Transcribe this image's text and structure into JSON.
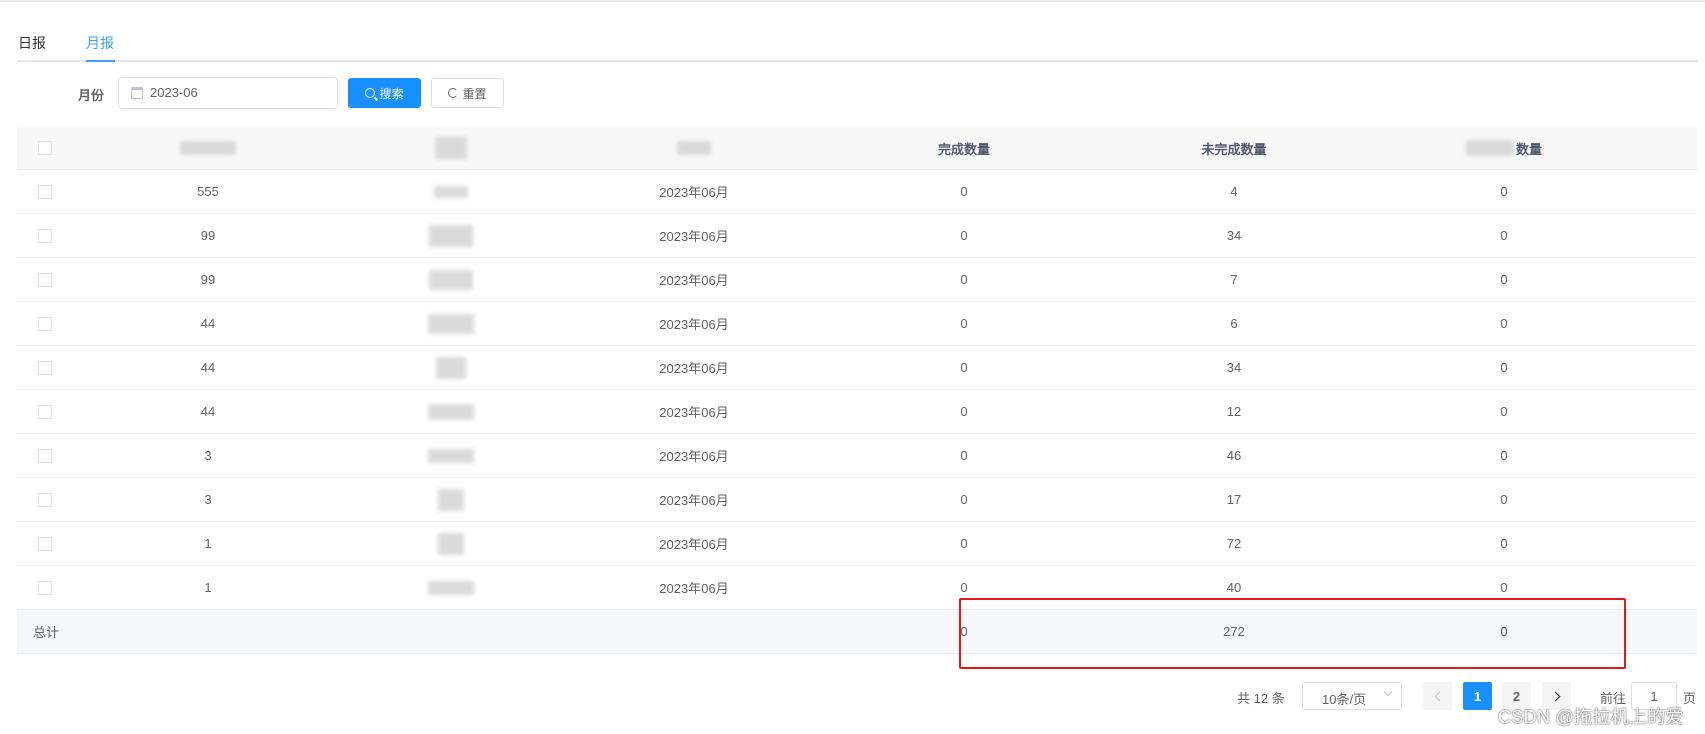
{
  "tabs": [
    {
      "label": "日报"
    },
    {
      "label": "月报"
    }
  ],
  "form": {
    "month_label": "月份",
    "month_value": "2023-06",
    "search_label": "搜索",
    "reset_label": "重置"
  },
  "table": {
    "headers": {
      "col3": "完成数量",
      "col4": "未完成数量",
      "col5_suffix": "数量"
    },
    "rows": [
      {
        "c1": "555",
        "month": "2023年06月",
        "done": "0",
        "undone": "4",
        "c5": "0"
      },
      {
        "c1": "99",
        "month": "2023年06月",
        "done": "0",
        "undone": "34",
        "c5": "0"
      },
      {
        "c1": "99",
        "month": "2023年06月",
        "done": "0",
        "undone": "7",
        "c5": "0"
      },
      {
        "c1": "44",
        "month": "2023年06月",
        "done": "0",
        "undone": "6",
        "c5": "0"
      },
      {
        "c1": "44",
        "month": "2023年06月",
        "done": "0",
        "undone": "34",
        "c5": "0"
      },
      {
        "c1": "44",
        "month": "2023年06月",
        "done": "0",
        "undone": "12",
        "c5": "0"
      },
      {
        "c1": "3",
        "month": "2023年06月",
        "done": "0",
        "undone": "46",
        "c5": "0"
      },
      {
        "c1": "3",
        "month": "2023年06月",
        "done": "0",
        "undone": "17",
        "c5": "0"
      },
      {
        "c1": "1",
        "month": "2023年06月",
        "done": "0",
        "undone": "72",
        "c5": "0"
      },
      {
        "c1": "1",
        "month": "2023年06月",
        "done": "0",
        "undone": "40",
        "c5": "0"
      }
    ],
    "footer": {
      "label": "总计",
      "done": "0",
      "undone": "272",
      "c5": "0"
    }
  },
  "pagination": {
    "total_text": "共 12 条",
    "page_size": "10条/页",
    "pages": [
      "1",
      "2"
    ],
    "current_page": "1",
    "goto_label": "前往",
    "goto_value": "1",
    "page_suffix": "页"
  },
  "watermark": "CSDN @拖拉机上的爱",
  "colors": {
    "primary": "#1890ff",
    "highlight_box": "#e6161a"
  }
}
